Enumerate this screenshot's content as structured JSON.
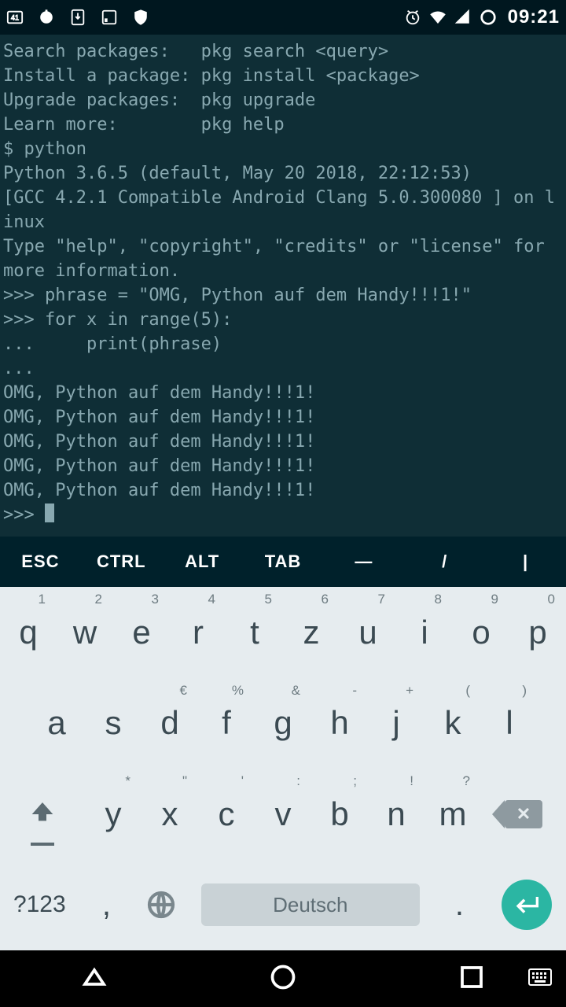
{
  "status": {
    "time": "09:21",
    "badge41": "41"
  },
  "terminal": {
    "lines": [
      "Search packages:   pkg search <query>",
      "Install a package: pkg install <package>",
      "Upgrade packages:  pkg upgrade",
      "Learn more:        pkg help",
      "$ python",
      "Python 3.6.5 (default, May 20 2018, 22:12:53)",
      "[GCC 4.2.1 Compatible Android Clang 5.0.300080 ] on linux",
      "Type \"help\", \"copyright\", \"credits\" or \"license\" for more information.",
      ">>> phrase = \"OMG, Python auf dem Handy!!!1!\"",
      ">>> for x in range(5):",
      "...     print(phrase)",
      "...",
      "OMG, Python auf dem Handy!!!1!",
      "OMG, Python auf dem Handy!!!1!",
      "OMG, Python auf dem Handy!!!1!",
      "OMG, Python auf dem Handy!!!1!",
      "OMG, Python auf dem Handy!!!1!"
    ],
    "prompt": ">>> "
  },
  "extra_keys": [
    "ESC",
    "CTRL",
    "ALT",
    "TAB",
    "—",
    "/",
    "|"
  ],
  "keyboard": {
    "row1": [
      {
        "main": "q",
        "hint": "1"
      },
      {
        "main": "w",
        "hint": "2"
      },
      {
        "main": "e",
        "hint": "3"
      },
      {
        "main": "r",
        "hint": "4"
      },
      {
        "main": "t",
        "hint": "5"
      },
      {
        "main": "z",
        "hint": "6"
      },
      {
        "main": "u",
        "hint": "7"
      },
      {
        "main": "i",
        "hint": "8"
      },
      {
        "main": "o",
        "hint": "9"
      },
      {
        "main": "p",
        "hint": "0"
      }
    ],
    "row2": [
      {
        "main": "a",
        "hint": ""
      },
      {
        "main": "s",
        "hint": ""
      },
      {
        "main": "d",
        "hint": "€"
      },
      {
        "main": "f",
        "hint": "%"
      },
      {
        "main": "g",
        "hint": "&"
      },
      {
        "main": "h",
        "hint": "-"
      },
      {
        "main": "j",
        "hint": "+"
      },
      {
        "main": "k",
        "hint": "("
      },
      {
        "main": "l",
        "hint": ")"
      }
    ],
    "row3": [
      {
        "main": "y",
        "hint": "*"
      },
      {
        "main": "x",
        "hint": "\""
      },
      {
        "main": "c",
        "hint": "'"
      },
      {
        "main": "v",
        "hint": ":"
      },
      {
        "main": "b",
        "hint": ";"
      },
      {
        "main": "n",
        "hint": "!"
      },
      {
        "main": "m",
        "hint": "?"
      }
    ],
    "mode_label": "?123",
    "comma": ",",
    "period": ".",
    "space_label": "Deutsch"
  }
}
